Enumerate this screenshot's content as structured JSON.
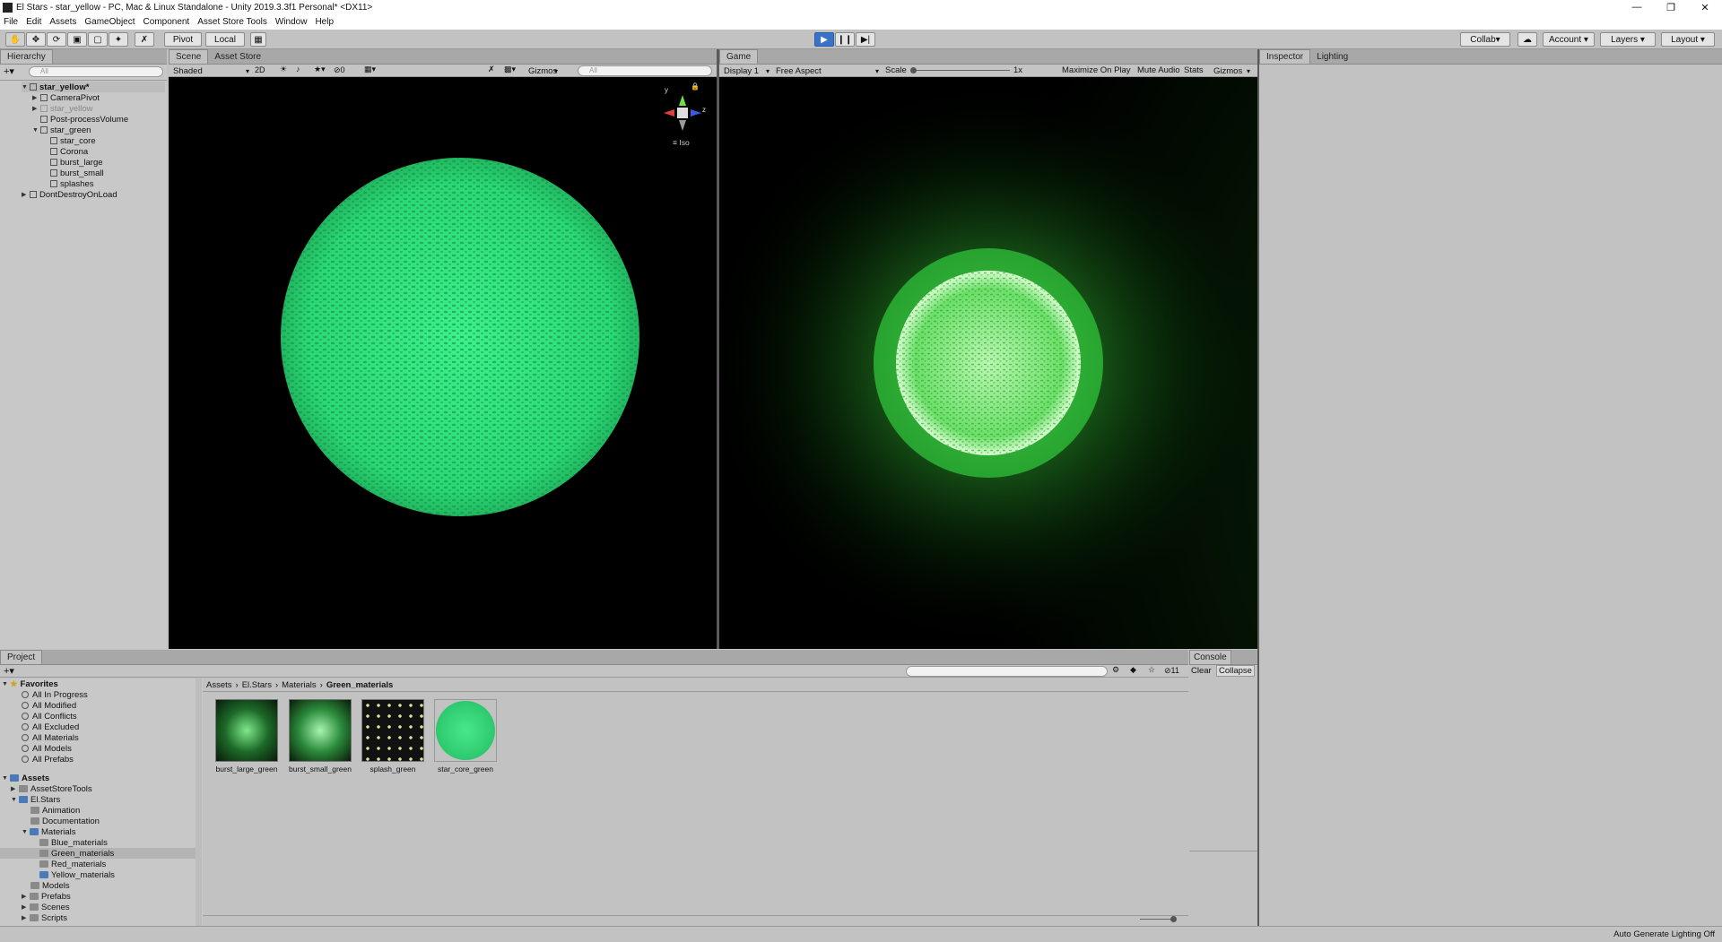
{
  "window": {
    "title": "El Stars - star_yellow - PC, Mac & Linux Standalone - Unity 2019.3.3f1 Personal* <DX11>"
  },
  "menu": [
    "File",
    "Edit",
    "Assets",
    "GameObject",
    "Component",
    "Asset Store Tools",
    "Window",
    "Help"
  ],
  "toolbar": {
    "pivot": "Pivot",
    "local": "Local",
    "collab": "Collab",
    "account": "Account",
    "layers": "Layers",
    "layout": "Layout"
  },
  "hierarchy": {
    "tab": "Hierarchy",
    "search_placeholder": "All",
    "items": [
      {
        "label": "star_yellow*",
        "bold": true
      },
      {
        "label": "CameraPivot"
      },
      {
        "label": "star_yellow",
        "dim": true
      },
      {
        "label": "Post-processVolume"
      },
      {
        "label": "star_green"
      },
      {
        "label": "star_core"
      },
      {
        "label": "Corona"
      },
      {
        "label": "burst_large"
      },
      {
        "label": "burst_small"
      },
      {
        "label": "splashes"
      },
      {
        "label": "DontDestroyOnLoad"
      }
    ]
  },
  "scene": {
    "tab": "Scene",
    "asset_store_tab": "Asset Store",
    "shading": "Shaded",
    "mode2d": "2D",
    "gizmos": "Gizmos",
    "search_placeholder": "All",
    "hidden_count": "0",
    "iso": "Iso",
    "axis_y": "y",
    "axis_z": "z"
  },
  "game": {
    "tab": "Game",
    "display": "Display 1",
    "aspect": "Free Aspect",
    "scale_label": "Scale",
    "scale_value": "1x",
    "maximize": "Maximize On Play",
    "mute": "Mute Audio",
    "stats": "Stats",
    "gizmos": "Gizmos"
  },
  "inspector": {
    "tab": "Inspector",
    "lighting_tab": "Lighting"
  },
  "project": {
    "tab": "Project",
    "favorites_label": "Favorites",
    "favorites": [
      "All In Progress",
      "All Modified",
      "All Conflicts",
      "All Excluded",
      "All Materials",
      "All Models",
      "All Prefabs"
    ],
    "assets_label": "Assets",
    "tree": [
      "AssetStoreTools",
      "El.Stars",
      "Animation",
      "Documentation",
      "Materials",
      "Blue_materials",
      "Green_materials",
      "Red_materials",
      "Yellow_materials",
      "Models",
      "Prefabs",
      "Scenes",
      "Scripts"
    ],
    "breadcrumb": [
      "Assets",
      "El.Stars",
      "Materials",
      "Green_materials"
    ],
    "files": [
      "burst_large_green",
      "burst_small_green",
      "splash_green",
      "star_core_green"
    ],
    "hidden_count": "11"
  },
  "console": {
    "tab": "Console",
    "clear": "Clear",
    "collapse": "Collapse"
  },
  "status": {
    "text": "Auto Generate Lighting Off"
  },
  "colors": {
    "accent_play": "#3a72c8",
    "sphere": "#2fe07a",
    "glow": "#4cff5a"
  }
}
